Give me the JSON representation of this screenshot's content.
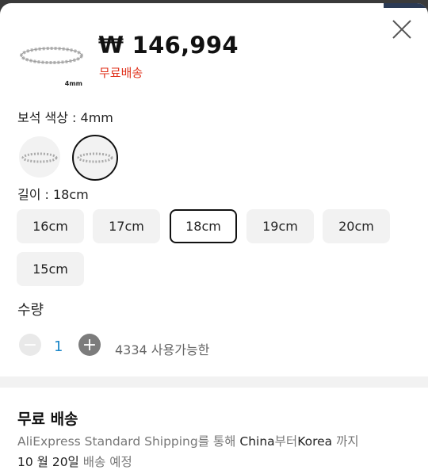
{
  "price": "₩ 146,994",
  "free_shipping_badge": "무료배송",
  "thumbnail_caption": "4mm",
  "gem_color": {
    "label": "보석 색상 : 4mm"
  },
  "length": {
    "label": "길이 : 18cm",
    "options": [
      "16cm",
      "17cm",
      "18cm",
      "19cm",
      "20cm",
      "15cm"
    ],
    "selected": "18cm"
  },
  "quantity": {
    "label": "수량",
    "minus": "−",
    "value": "1",
    "plus": "+",
    "available": "4334 사용가능한"
  },
  "shipping": {
    "title": "무료 배송",
    "carrier": "AliExpress Standard Shipping",
    "via": "를 통해 ",
    "origin": "China",
    "from": "부터",
    "destination": "Korea",
    "until": " 까지",
    "date": "10 월 20일",
    "eta_label": " 배송 예정"
  },
  "colors": {
    "price": "#111111",
    "free": "#e0331d",
    "qty_value": "#1a86c8"
  },
  "icons": {
    "close": "close-icon",
    "minus": "minus-icon",
    "plus": "plus-icon"
  }
}
